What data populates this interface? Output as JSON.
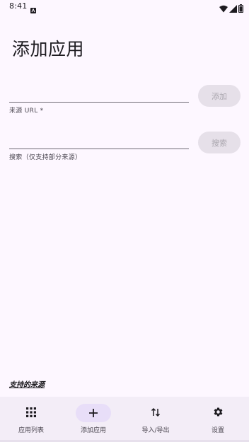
{
  "status_bar": {
    "time": "8:41"
  },
  "page": {
    "title": "添加应用"
  },
  "source_url": {
    "value": "",
    "label": "来源 URL *",
    "button_label": "添加"
  },
  "search": {
    "value": "",
    "label": "搜索（仅支持部分来源）",
    "button_label": "搜索"
  },
  "supported_sources_link": "支持的来源",
  "bottom_nav": {
    "items": [
      {
        "label": "应用列表",
        "icon": "grid-icon",
        "active": false
      },
      {
        "label": "添加应用",
        "icon": "plus-icon",
        "active": true
      },
      {
        "label": "导入/导出",
        "icon": "swap-vertical-icon",
        "active": false
      },
      {
        "label": "设置",
        "icon": "gear-icon",
        "active": false
      }
    ]
  },
  "colors": {
    "background": "#fdf7ff",
    "nav_background": "#f3edf7",
    "active_indicator": "#e8def8",
    "disabled_button": "#e6e0e9",
    "text_primary": "#1d1b20",
    "text_secondary": "#49454f"
  }
}
